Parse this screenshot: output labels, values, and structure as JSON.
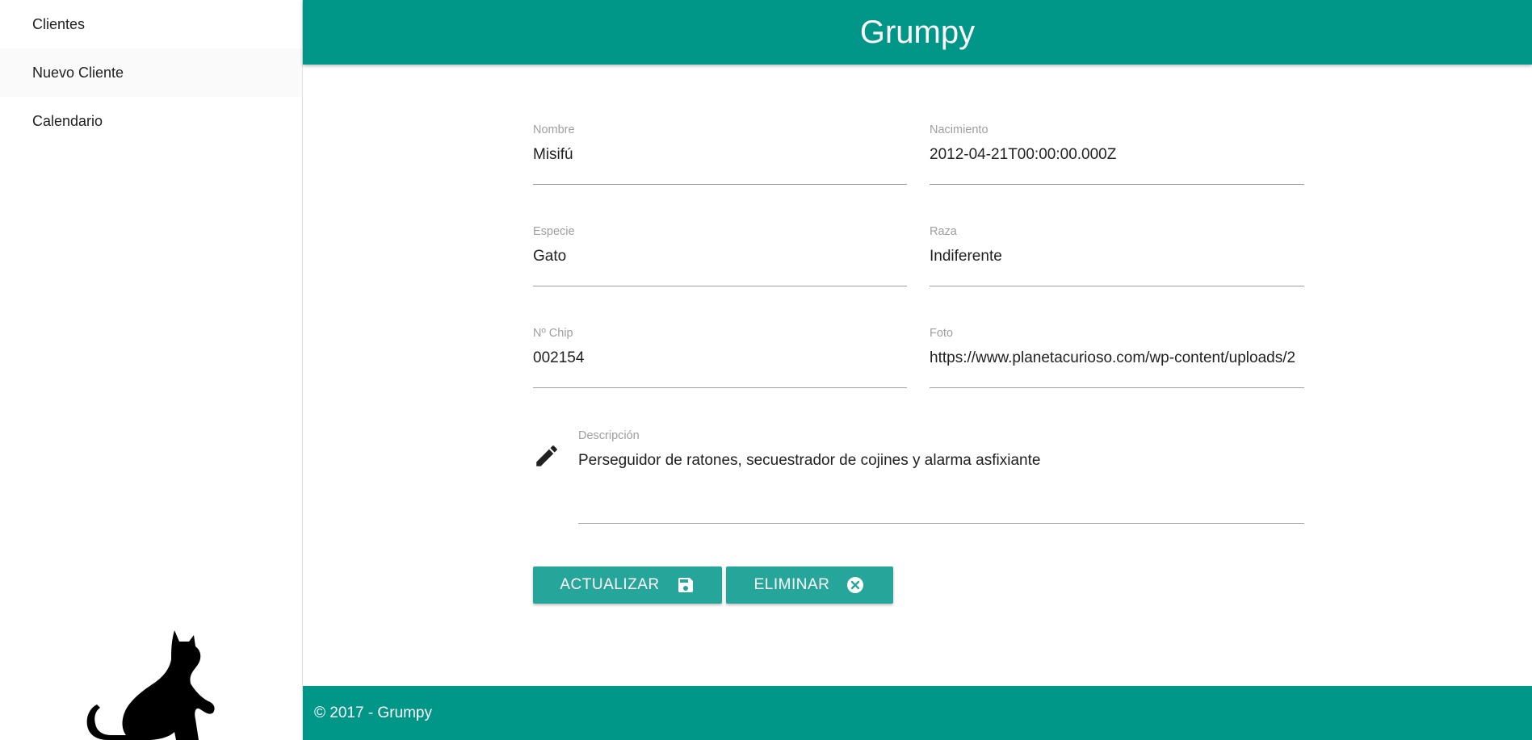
{
  "sidebar": {
    "items": [
      {
        "label": "Clientes"
      },
      {
        "label": "Nuevo Cliente"
      },
      {
        "label": "Calendario"
      }
    ]
  },
  "header": {
    "title": "Grumpy"
  },
  "form": {
    "nombre": {
      "label": "Nombre",
      "value": "Misifú"
    },
    "nacimiento": {
      "label": "Nacimiento",
      "value": "2012-04-21T00:00:00.000Z"
    },
    "especie": {
      "label": "Especie",
      "value": "Gato"
    },
    "raza": {
      "label": "Raza",
      "value": "Indiferente"
    },
    "chip": {
      "label": "Nº Chip",
      "value": "002154"
    },
    "foto": {
      "label": "Foto",
      "value": "https://www.planetacurioso.com/wp-content/uploads/2"
    },
    "descripcion": {
      "label": "Descripción",
      "value": "Perseguidor de ratones, secuestrador de cojines y alarma asfixiante"
    }
  },
  "buttons": {
    "update": "ACTUALIZAR",
    "delete": "ELIMINAR"
  },
  "footer": {
    "text": "© 2017 - Grumpy"
  },
  "colors": {
    "primary": "#009688",
    "button": "#26a69a"
  }
}
